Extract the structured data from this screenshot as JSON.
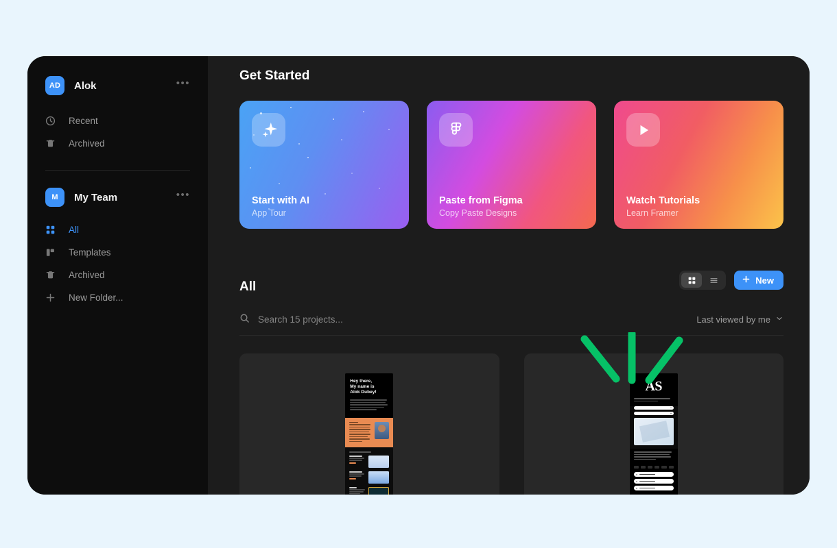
{
  "app": {
    "background_color": "#e9f5fd",
    "panel_color": "#1c1c1c",
    "sidebar_color": "#0d0d0d",
    "accent_color": "#3d92f8",
    "annotation_color": "#06c167"
  },
  "sidebar": {
    "user": {
      "initials": "AD",
      "name": "Alok",
      "menu_label": "•••"
    },
    "user_items": [
      {
        "icon": "clock-icon",
        "label": "Recent"
      },
      {
        "icon": "trash-icon",
        "label": "Archived"
      }
    ],
    "team": {
      "initials": "M",
      "name": "My Team",
      "menu_label": "•••"
    },
    "team_items": [
      {
        "icon": "grid-icon",
        "label": "All",
        "active": true
      },
      {
        "icon": "templates-icon",
        "label": "Templates",
        "active": false
      },
      {
        "icon": "trash-icon",
        "label": "Archived",
        "active": false
      },
      {
        "icon": "plus-icon",
        "label": "New Folder...",
        "active": false
      }
    ]
  },
  "main": {
    "get_started": {
      "title": "Get Started",
      "cards": [
        {
          "id": "card-ai",
          "icon": "sparkle-icon",
          "title": "Start with AI",
          "subtitle": "App Tour"
        },
        {
          "id": "card-figma",
          "icon": "figma-icon",
          "title": "Paste from Figma",
          "subtitle": "Copy Paste Designs"
        },
        {
          "id": "card-tutorials",
          "icon": "play-icon",
          "title": "Watch Tutorials",
          "subtitle": "Learn Framer"
        }
      ]
    },
    "all_section": {
      "title": "All",
      "view_grid_icon": "grid-view-icon",
      "view_list_icon": "list-view-icon",
      "active_view": "grid",
      "new_button": {
        "label": "New",
        "icon": "plus-icon"
      },
      "search": {
        "icon": "search-icon",
        "placeholder": "Search 15 projects...",
        "value": ""
      },
      "sort": {
        "label": "Last viewed by me",
        "icon": "chevron-down-icon"
      },
      "projects": [
        {
          "id": "project-portfolio",
          "thumbnail": "portfolio-preview",
          "hero_line_1": "Hey there,",
          "hero_line_2": "My name is",
          "hero_line_3": "Alok Dubey!"
        },
        {
          "id": "project-as",
          "thumbnail": "as-preview",
          "monogram": "AS"
        }
      ]
    }
  }
}
